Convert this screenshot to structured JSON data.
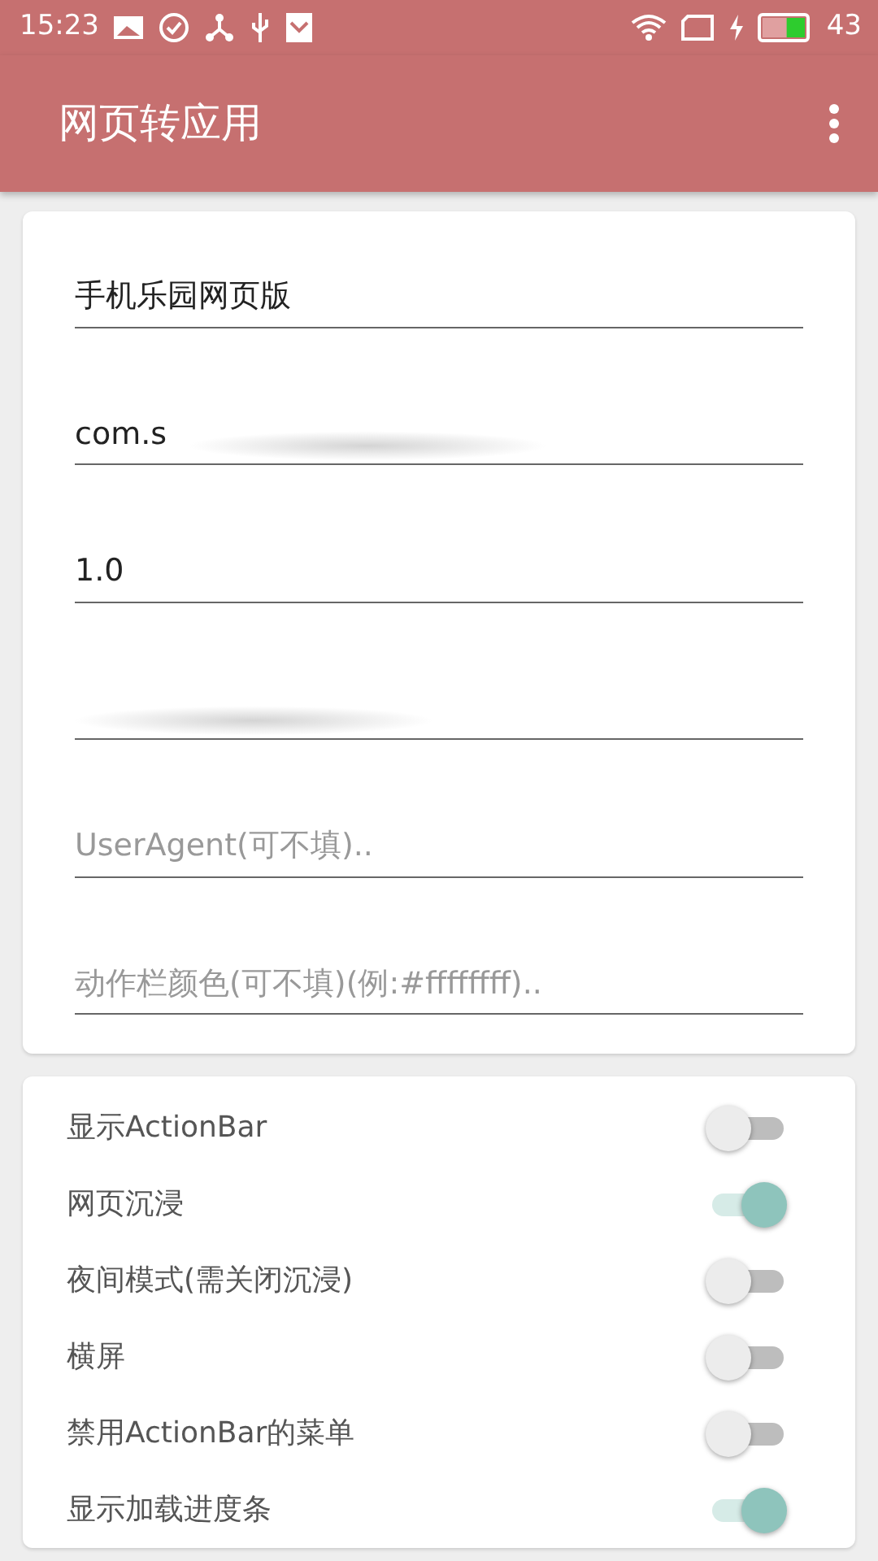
{
  "status_bar": {
    "time": "15:23",
    "battery": "43"
  },
  "app_bar": {
    "title": "网页转应用"
  },
  "fields": [
    {
      "value": "手机乐园网页版",
      "blurred": false
    },
    {
      "value": "com.s",
      "blurred": true
    },
    {
      "value": "1.0",
      "blurred": false
    },
    {
      "blurred": true
    },
    {
      "placeholder": "UserAgent(可不填)..",
      "blurred": false
    },
    {
      "placeholder": "动作栏颜色(可不填)(例:#ffffffff)..",
      "blurred": false
    }
  ],
  "switches": [
    {
      "label": "显示ActionBar",
      "on": false
    },
    {
      "label": "网页沉浸",
      "on": true
    },
    {
      "label": "夜间模式(需关闭沉浸)",
      "on": false
    },
    {
      "label": "横屏",
      "on": false
    },
    {
      "label": "禁用ActionBar的菜单",
      "on": false
    },
    {
      "label": "显示加载进度条",
      "on": true
    }
  ]
}
